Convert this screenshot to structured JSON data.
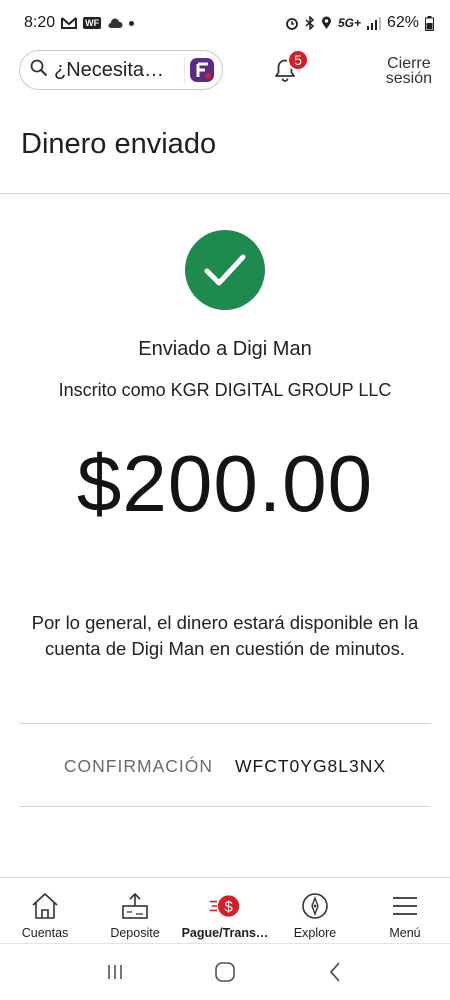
{
  "status_bar": {
    "time": "8:20",
    "app_badge": "WF",
    "network": "5G+",
    "battery": "62%"
  },
  "header": {
    "search_placeholder": "¿Necesita…",
    "notification_count": "5",
    "signout_line1": "Cierre",
    "signout_line2": "sesión"
  },
  "page": {
    "title": "Dinero enviado",
    "sent_to": "Enviado a Digi Man",
    "enrolled_as": "Inscrito como KGR DIGITAL GROUP LLC",
    "amount": "$200.00",
    "note": "Por lo general, el dinero estará disponible en la cuenta de Digi Man en cuestión de minutos.",
    "confirmation_label": "CONFIRMACIÓN",
    "confirmation_value": "WFCT0YG8L3NX"
  },
  "bottom_nav": {
    "items": [
      {
        "label": "Cuentas",
        "icon": "house-icon"
      },
      {
        "label": "Deposite",
        "icon": "deposit-icon"
      },
      {
        "label": "Pague/Trans…",
        "icon": "pay-transfer-icon",
        "active": true
      },
      {
        "label": "Explore",
        "icon": "compass-icon"
      },
      {
        "label": "Menú",
        "icon": "hamburger-icon"
      }
    ]
  },
  "colors": {
    "success_green": "#1e8a4f",
    "brand_red": "#d71e28",
    "fargo_purple": "#5b2a86"
  }
}
